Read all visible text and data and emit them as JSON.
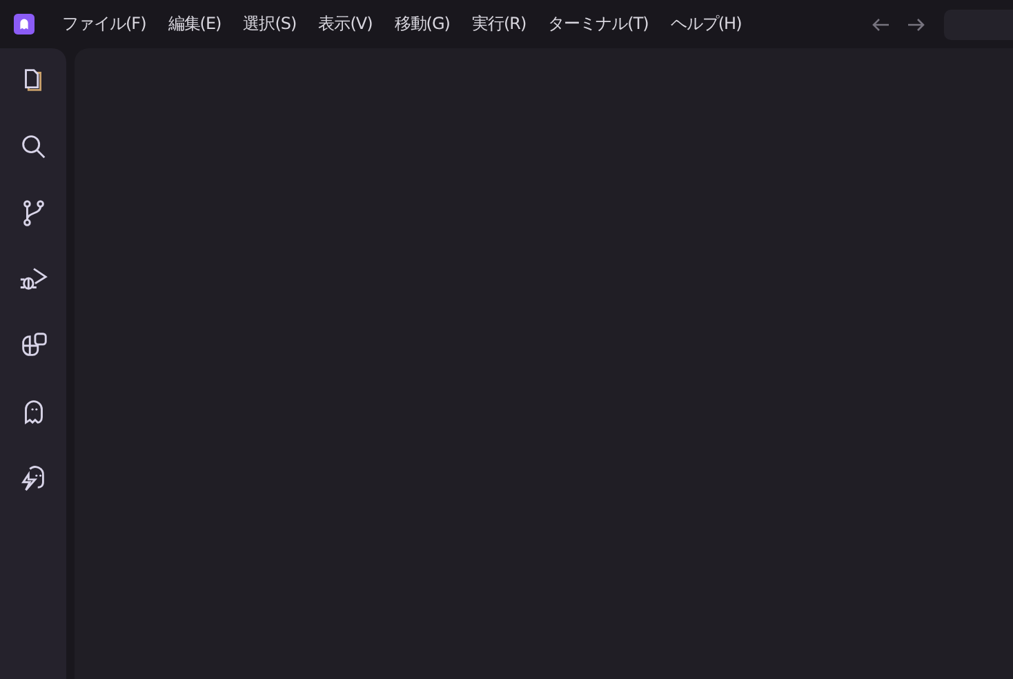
{
  "menu": [
    {
      "label": "ファイル(F)"
    },
    {
      "label": "編集(E)"
    },
    {
      "label": "選択(S)"
    },
    {
      "label": "表示(V)"
    },
    {
      "label": "移動(G)"
    },
    {
      "label": "実行(R)"
    },
    {
      "label": "ターミナル(T)"
    },
    {
      "label": "ヘルプ(H)"
    }
  ]
}
